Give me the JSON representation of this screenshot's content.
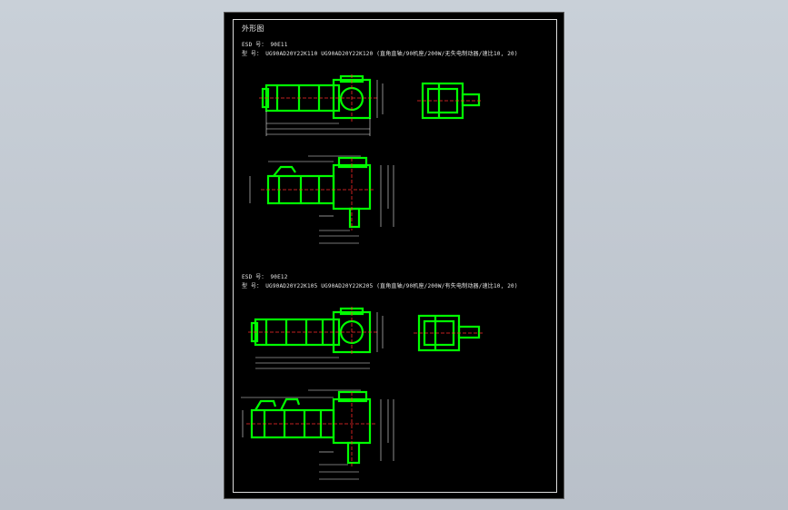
{
  "drawing": {
    "title": "外形图",
    "section1": {
      "code_line": "ESD 号：  90E11",
      "model_line": "型  号：   UG90AD20Y22K110    UG90AD20Y22K120    (直角直轴/90机座/200W/无失电制动器/速比10, 20)"
    },
    "section2": {
      "code_line": "ESD 号：  90E12",
      "model_line": "型  号：   UG90AD20Y22K105    UG90AD20Y22K205    (直角直轴/90机座/200W/有失电制动器/速比10, 20)"
    }
  },
  "colors": {
    "background": "#c4cbd3",
    "sheet": "#000000",
    "outline": "#00ff00",
    "dimension": "#e8e8e8",
    "centerline": "#ff2a2a"
  }
}
